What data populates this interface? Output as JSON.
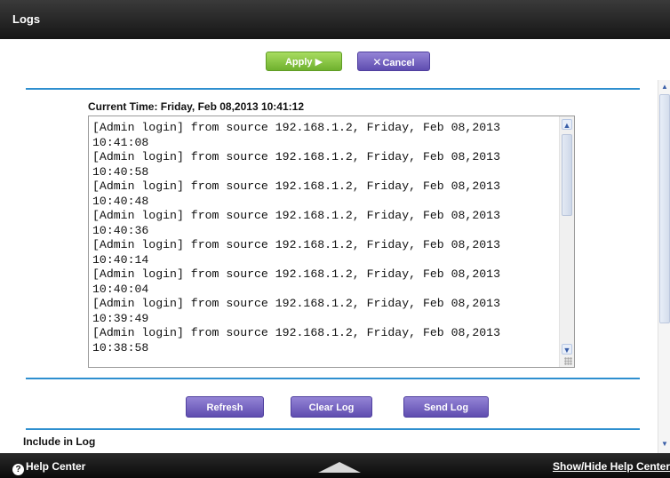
{
  "header": {
    "title": "Logs"
  },
  "toolbar": {
    "apply_label": "Apply ▶",
    "cancel_label": "Cancel"
  },
  "log": {
    "current_time_label": "Current Time: Friday, Feb 08,2013 10:41:12",
    "lines": [
      "[Admin login] from source 192.168.1.2, Friday, Feb 08,2013",
      "10:41:08",
      "[Admin login] from source 192.168.1.2, Friday, Feb 08,2013",
      "10:40:58",
      "[Admin login] from source 192.168.1.2, Friday, Feb 08,2013",
      "10:40:48",
      "[Admin login] from source 192.168.1.2, Friday, Feb 08,2013",
      "10:40:36",
      "[Admin login] from source 192.168.1.2, Friday, Feb 08,2013",
      "10:40:14",
      "[Admin login] from source 192.168.1.2, Friday, Feb 08,2013",
      "10:40:04",
      "[Admin login] from source 192.168.1.2, Friday, Feb 08,2013",
      "10:39:49",
      "[Admin login] from source 192.168.1.2, Friday, Feb 08,2013",
      "10:38:58"
    ]
  },
  "actions": {
    "refresh_label": "Refresh",
    "clear_log_label": "Clear Log",
    "send_log_label": "Send Log"
  },
  "include_in_log": {
    "label": "Include in Log"
  },
  "footer": {
    "help_center_label": "Help Center",
    "help_icon": "?",
    "show_hide_label": "Show/Hide Help Center"
  },
  "icons": {
    "cancel": "cancel-x-icon",
    "scroll_up": "scroll-up-arrow-icon",
    "scroll_down": "scroll-down-arrow-icon",
    "help": "help-icon",
    "toggle": "up-triangle-icon"
  },
  "colors": {
    "accent_blue": "#2e8fcf",
    "apply_green": "#6fb12e",
    "button_purple": "#5f4db0",
    "header_dark": "#1e1e1e"
  }
}
